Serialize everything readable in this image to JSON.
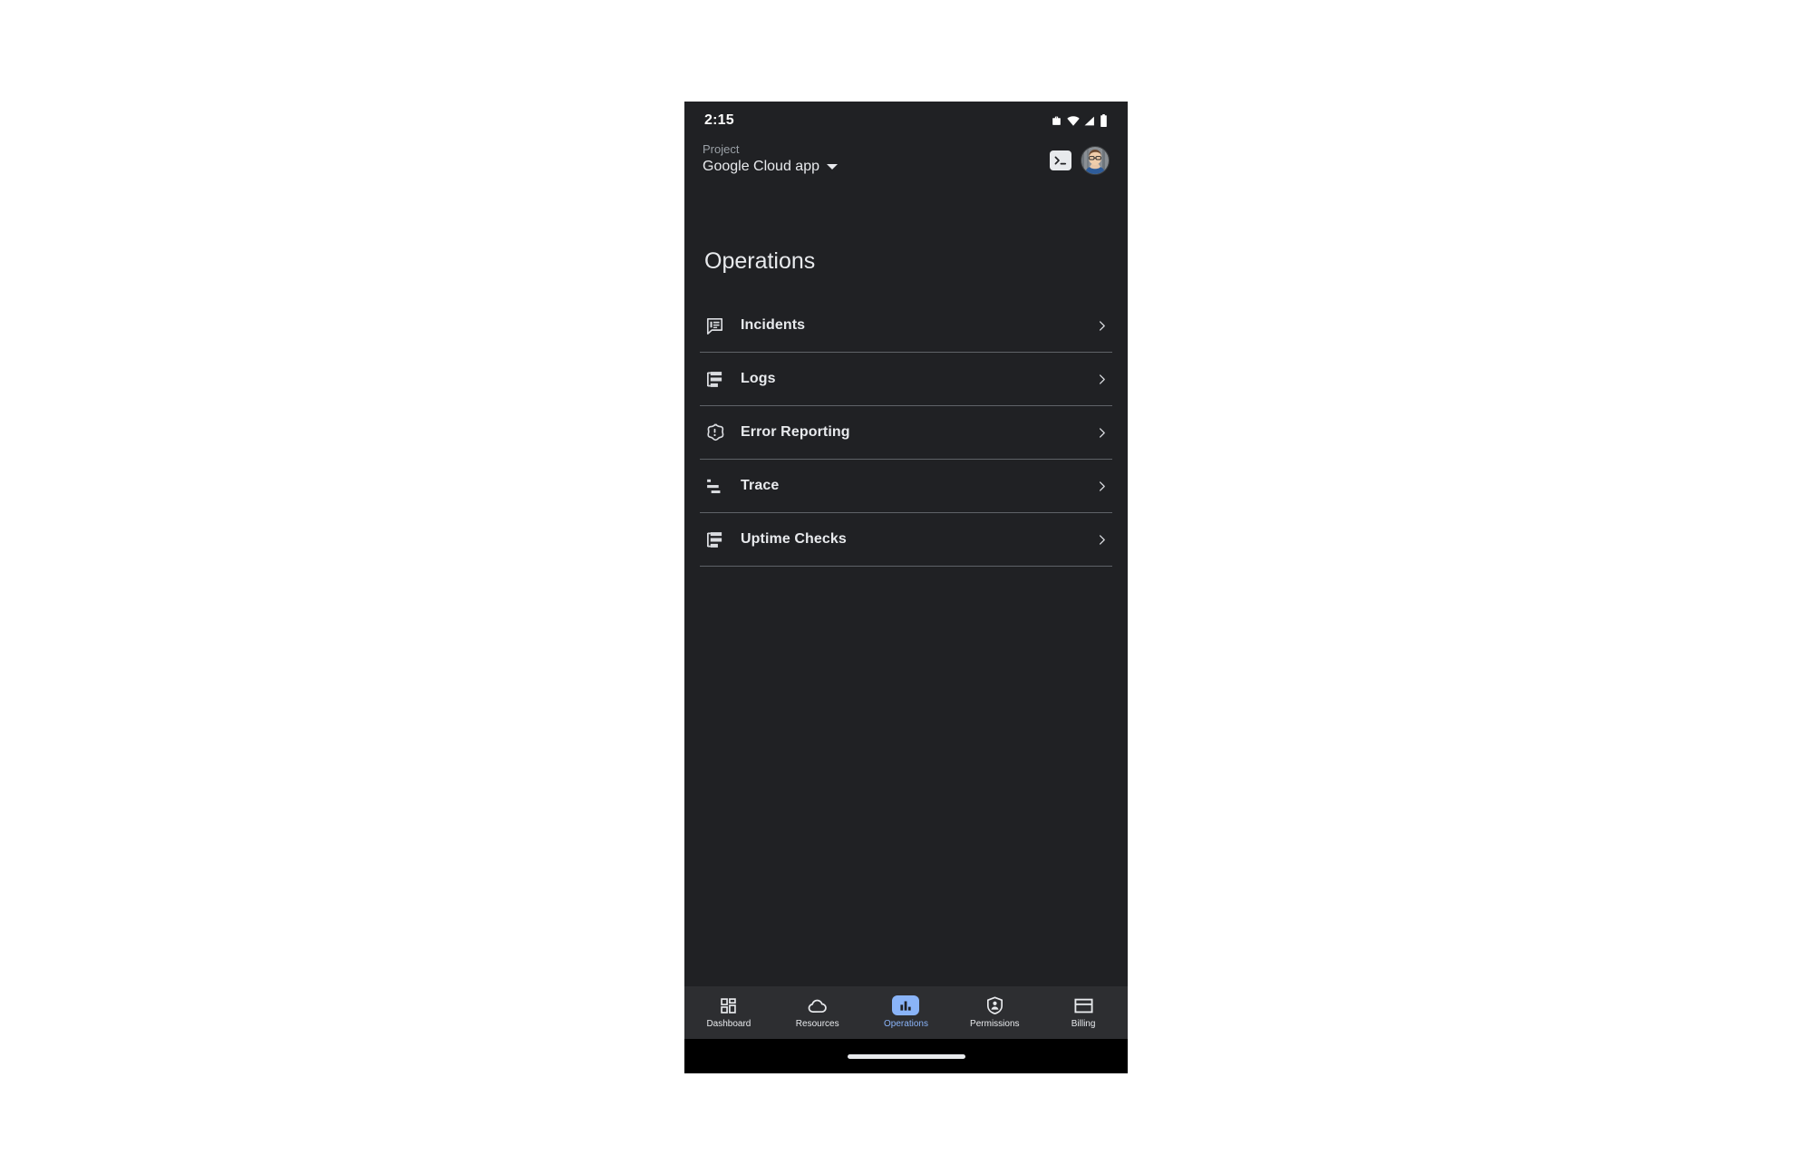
{
  "status_bar": {
    "time": "2:15",
    "icons": [
      "work-briefcase-icon",
      "wifi-icon",
      "cell-signal-icon",
      "battery-icon"
    ]
  },
  "header": {
    "project_label": "Project",
    "project_name": "Google Cloud app",
    "dropdown_icon": "chevron-down-icon",
    "cloud_shell_icon": "terminal-icon",
    "avatar_icon": "user-avatar"
  },
  "page": {
    "title": "Operations"
  },
  "list": {
    "items": [
      {
        "label": "Incidents",
        "icon": "incidents-comment-icon",
        "chevron": "chevron-right-icon"
      },
      {
        "label": "Logs",
        "icon": "logs-list-icon",
        "chevron": "chevron-right-icon"
      },
      {
        "label": "Error Reporting",
        "icon": "error-burst-icon",
        "chevron": "chevron-right-icon"
      },
      {
        "label": "Trace",
        "icon": "trace-waterfall-icon",
        "chevron": "chevron-right-icon"
      },
      {
        "label": "Uptime Checks",
        "icon": "uptime-list-icon",
        "chevron": "chevron-right-icon"
      }
    ]
  },
  "bottom_nav": {
    "active": "Operations",
    "items": [
      {
        "label": "Dashboard",
        "icon": "grid-dashboard-icon",
        "active": false
      },
      {
        "label": "Resources",
        "icon": "cloud-icon",
        "active": false
      },
      {
        "label": "Operations",
        "icon": "bar-chart-icon",
        "active": true
      },
      {
        "label": "Permissions",
        "icon": "shield-person-icon",
        "active": false
      },
      {
        "label": "Billing",
        "icon": "credit-card-icon",
        "active": false
      }
    ]
  },
  "colors": {
    "background": "#202124",
    "nav_background": "#2d2e31",
    "accent": "#8ab4f8",
    "text_primary": "#e8eaed",
    "text_secondary": "#9aa0a6",
    "divider": "#5f6368"
  }
}
